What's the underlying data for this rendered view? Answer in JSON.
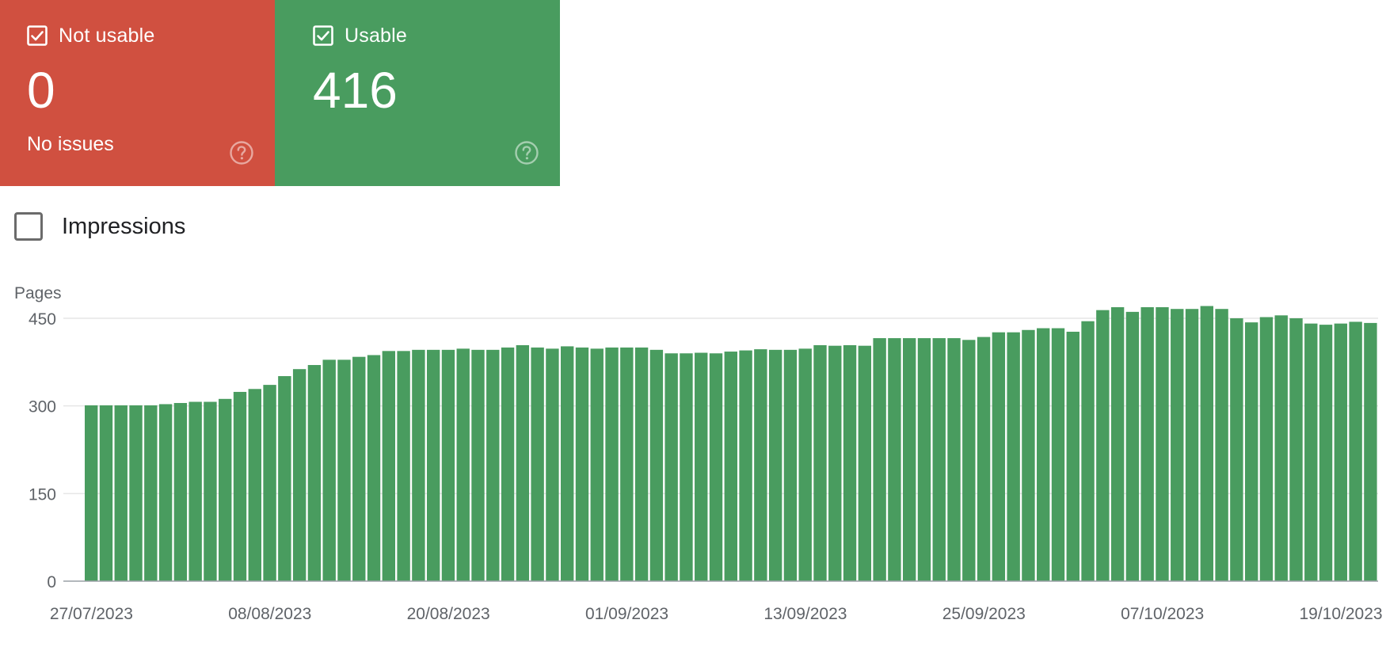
{
  "cards": {
    "not_usable": {
      "label": "Not usable",
      "count": "0",
      "subtitle": "No issues",
      "color": "#d05040"
    },
    "usable": {
      "label": "Usable",
      "count": "416",
      "color": "#499c5f"
    }
  },
  "impressions_label": "Impressions",
  "chart_data": {
    "type": "bar",
    "ylabel": "Pages",
    "ylim": [
      0,
      450
    ],
    "yticks": [
      "450",
      "300",
      "150",
      "0"
    ],
    "xticks": [
      "27/07/2023",
      "08/08/2023",
      "20/08/2023",
      "01/09/2023",
      "13/09/2023",
      "25/09/2023",
      "07/10/2023",
      "19/10/2023"
    ],
    "start_date": "27/07/2023",
    "bar_color": "#499c5f",
    "grid": true,
    "values": [
      301,
      301,
      301,
      301,
      301,
      303,
      305,
      307,
      307,
      312,
      324,
      329,
      336,
      351,
      363,
      370,
      379,
      379,
      384,
      387,
      394,
      394,
      396,
      396,
      396,
      398,
      396,
      396,
      400,
      404,
      400,
      398,
      402,
      400,
      398,
      400,
      400,
      400,
      396,
      390,
      390,
      391,
      390,
      393,
      395,
      397,
      396,
      396,
      398,
      404,
      403,
      404,
      403,
      416,
      416,
      416,
      416,
      416,
      416,
      413,
      418,
      426,
      426,
      430,
      433,
      433,
      427,
      445,
      464,
      469,
      461,
      469,
      469,
      466,
      466,
      471,
      466,
      450,
      443,
      452,
      455,
      450,
      441,
      439,
      441,
      444,
      442
    ]
  }
}
